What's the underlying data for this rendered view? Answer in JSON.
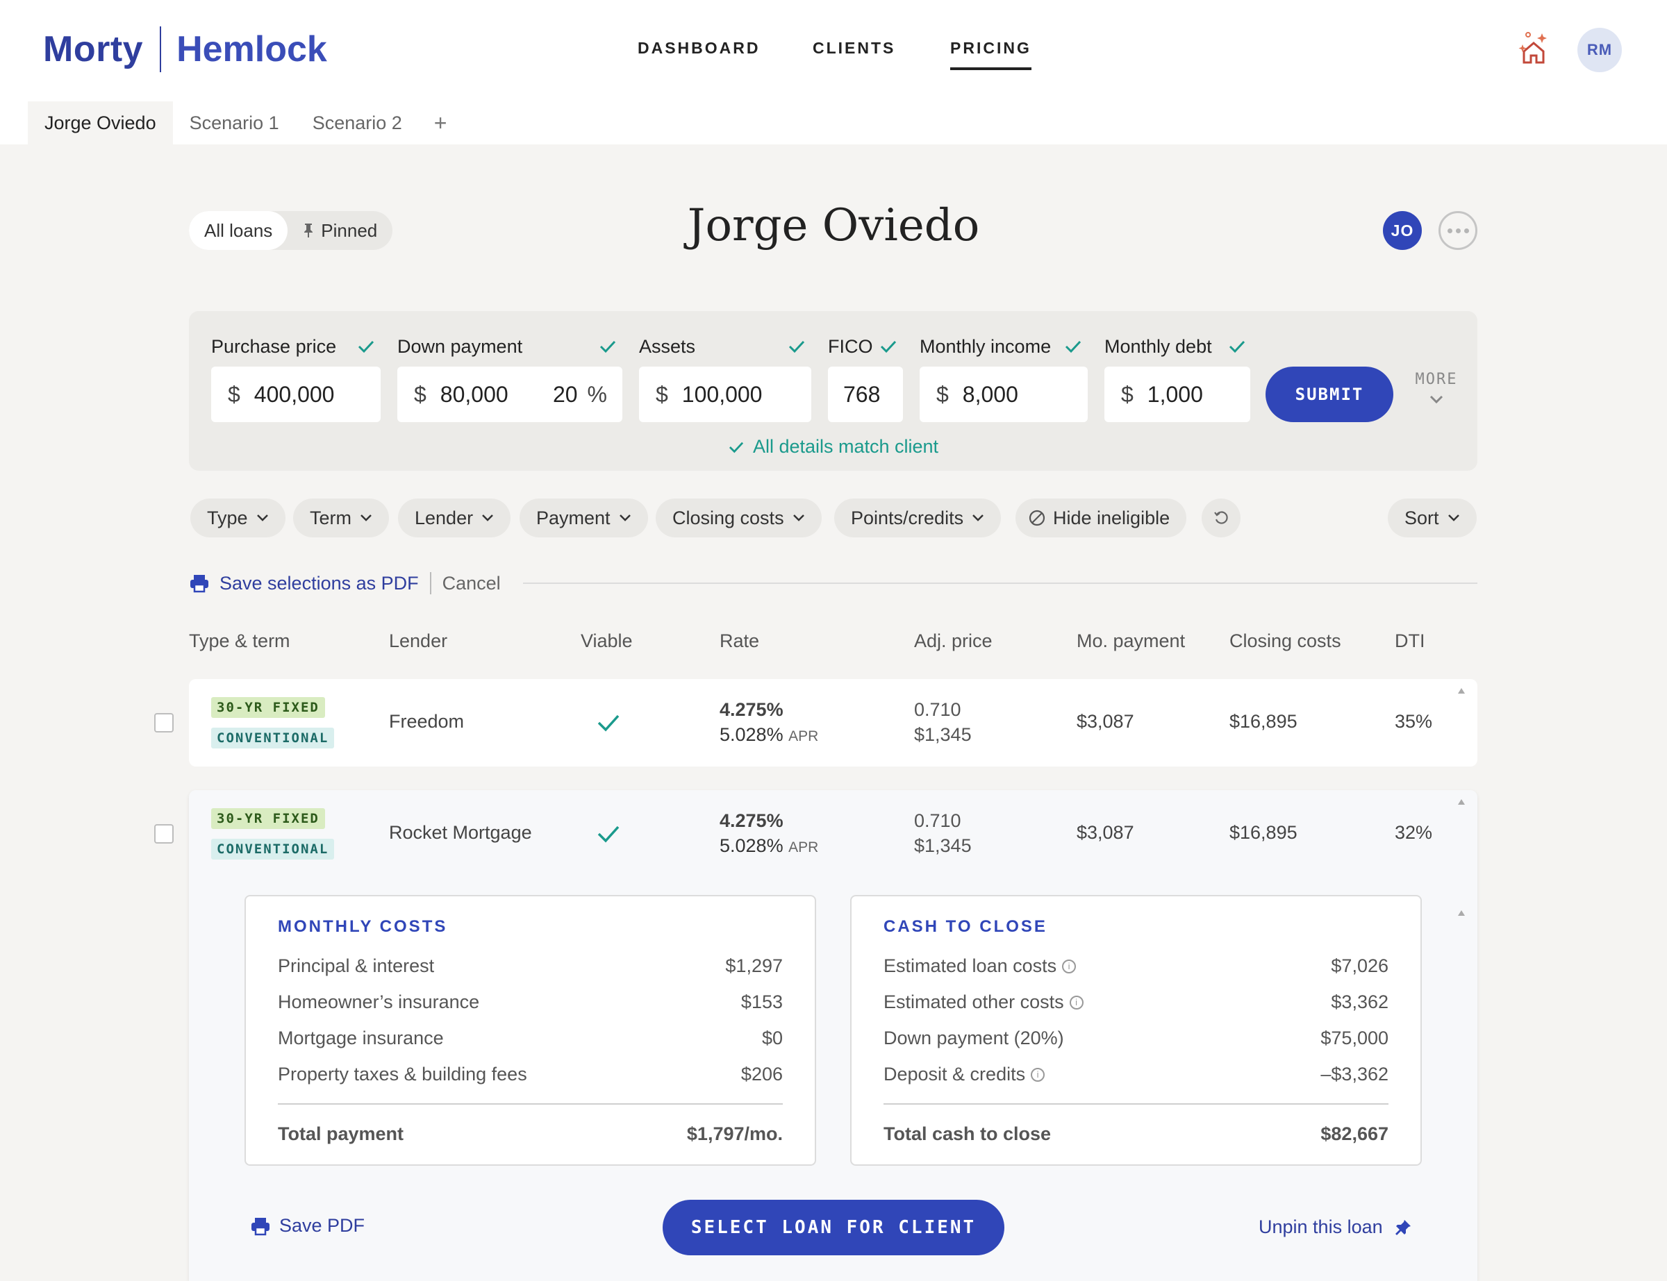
{
  "brand": {
    "name": "Morty",
    "partner": "Hemlock"
  },
  "nav": {
    "items": [
      "DASHBOARD",
      "CLIENTS",
      "PRICING"
    ],
    "active": "PRICING"
  },
  "user": {
    "initials": "RM"
  },
  "tabs": {
    "items": [
      "Jorge Oviedo",
      "Scenario 1",
      "Scenario 2"
    ],
    "add": "+"
  },
  "view_toggle": {
    "all": "All loans",
    "pinned": "Pinned"
  },
  "client": {
    "name": "Jorge Oviedo",
    "initials": "JO"
  },
  "inputs": {
    "purchase_price": {
      "label": "Purchase price",
      "currency": "$",
      "value": "400,000"
    },
    "down_payment": {
      "label": "Down payment",
      "currency": "$",
      "value": "80,000",
      "percent": "20",
      "percent_sign": "%"
    },
    "assets": {
      "label": "Assets",
      "currency": "$",
      "value": "100,000"
    },
    "fico": {
      "label": "FICO",
      "value": "768"
    },
    "monthly_income": {
      "label": "Monthly income",
      "currency": "$",
      "value": "8,000"
    },
    "monthly_debt": {
      "label": "Monthly debt",
      "currency": "$",
      "value": "1,000"
    },
    "submit": "SUBMIT",
    "more": "MORE",
    "match_status": "All details match client"
  },
  "filters": {
    "type": "Type",
    "term": "Term",
    "lender": "Lender",
    "payment": "Payment",
    "closing_costs": "Closing costs",
    "points_credits": "Points/credits",
    "hide_ineligible": "Hide ineligible",
    "sort": "Sort"
  },
  "selection_bar": {
    "save": "Save selections as PDF",
    "cancel": "Cancel"
  },
  "table": {
    "headers": [
      "Type & term",
      "Lender",
      "Viable",
      "Rate",
      "Adj. price",
      "Mo. payment",
      "Closing costs",
      "DTI"
    ],
    "rows": [
      {
        "term": "30-YR FIXED",
        "type": "CONVENTIONAL",
        "lender": "Freedom",
        "viable": true,
        "rate": "4.275%",
        "apr": "5.028%",
        "apr_label": "APR",
        "adj_points": "0.710",
        "adj_amount": "$1,345",
        "payment": "$3,087",
        "closing": "$16,895",
        "dti": "35%"
      },
      {
        "term": "30-YR FIXED",
        "type": "CONVENTIONAL",
        "lender": "Rocket Mortgage",
        "viable": true,
        "rate": "4.275%",
        "apr": "5.028%",
        "apr_label": "APR",
        "adj_points": "0.710",
        "adj_amount": "$1,345",
        "payment": "$3,087",
        "closing": "$16,895",
        "dti": "32%"
      }
    ]
  },
  "monthly_costs": {
    "title": "MONTHLY COSTS",
    "items": [
      {
        "label": "Principal & interest",
        "value": "$1,297"
      },
      {
        "label": "Homeowner’s insurance",
        "value": "$153"
      },
      {
        "label": "Mortgage insurance",
        "value": "$0"
      },
      {
        "label": "Property taxes & building fees",
        "value": "$206"
      }
    ],
    "total_label": "Total payment",
    "total_value": "$1,797/mo."
  },
  "cash_to_close": {
    "title": "CASH TO CLOSE",
    "items": [
      {
        "label": "Estimated loan costs",
        "value": "$7,026",
        "info": true
      },
      {
        "label": "Estimated other costs",
        "value": "$3,362",
        "info": true
      },
      {
        "label": "Down payment (20%)",
        "value": "$75,000",
        "info": false
      },
      {
        "label": "Deposit & credits",
        "value": "–$3,362",
        "info": true
      }
    ],
    "total_label": "Total cash to close",
    "total_value": "$82,667"
  },
  "actions": {
    "save_pdf": "Save PDF",
    "select": "SELECT LOAN FOR CLIENT",
    "unpin": "Unpin this loan"
  },
  "colors": {
    "brand": "#2f3e9e",
    "primary": "#3046b8",
    "success": "#1a9a8c"
  }
}
